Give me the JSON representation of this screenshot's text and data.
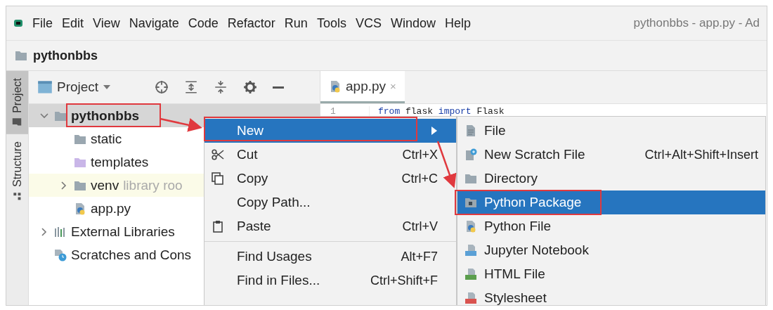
{
  "menu_bar": {
    "items": [
      "File",
      "Edit",
      "View",
      "Navigate",
      "Code",
      "Refactor",
      "Run",
      "Tools",
      "VCS",
      "Window",
      "Help"
    ],
    "window_title": "pythonbbs - app.py - Ad"
  },
  "breadcrumb": {
    "label": "pythonbbs"
  },
  "tool_strip": [
    {
      "label": "Project",
      "selected": true
    },
    {
      "label": "Structure",
      "selected": false
    }
  ],
  "project_panel": {
    "view": "Project",
    "tree": [
      {
        "label": "pythonbbs",
        "kind": "folder",
        "expanded": true,
        "selected": true,
        "library_root": false,
        "children": [
          {
            "label": "static",
            "kind": "folder",
            "selected": false,
            "library_root": false
          },
          {
            "label": "templates",
            "kind": "templates",
            "selected": false,
            "library_root": false
          },
          {
            "label": "venv",
            "kind": "folder",
            "hint": "library roo",
            "expanded": false,
            "selected": false,
            "library_root": true
          },
          {
            "label": "app.py",
            "kind": "python",
            "selected": false,
            "library_root": false
          }
        ]
      },
      {
        "label": "External Libraries",
        "kind": "libraries",
        "expanded": false,
        "selected": false,
        "library_root": false
      },
      {
        "label": "Scratches and Cons",
        "kind": "scratches",
        "selected": false,
        "library_root": false
      }
    ]
  },
  "editor": {
    "tabs": [
      {
        "label": "app.py",
        "close": "×",
        "selected": true
      }
    ],
    "line_number": "1",
    "code": [
      {
        "text": "from",
        "kind": "keyword"
      },
      {
        "text": " flask ",
        "kind": "plain"
      },
      {
        "text": "import",
        "kind": "keyword"
      },
      {
        "text": " Flask",
        "kind": "plain"
      }
    ]
  },
  "context_menu": {
    "items": [
      {
        "label": "New",
        "kind": "submenu",
        "selected": true
      },
      {
        "label": "Cut",
        "kind": "cut",
        "shortcut": "Ctrl+X",
        "selected": false
      },
      {
        "label": "Copy",
        "kind": "copy",
        "shortcut": "Ctrl+C",
        "selected": false
      },
      {
        "label": "Copy Path...",
        "kind": "plain",
        "selected": false
      },
      {
        "label": "Paste",
        "kind": "paste",
        "shortcut": "Ctrl+V",
        "selected": false
      },
      {
        "kind": "separator"
      },
      {
        "label": "Find Usages",
        "kind": "plain",
        "shortcut": "Alt+F7",
        "selected": false
      },
      {
        "label": "Find in Files...",
        "kind": "plain",
        "shortcut": "Ctrl+Shift+F",
        "selected": false
      }
    ]
  },
  "submenu": {
    "items": [
      {
        "label": "File",
        "kind": "file",
        "selected": false
      },
      {
        "label": "New Scratch File",
        "kind": "scratch",
        "shortcut": "Ctrl+Alt+Shift+Insert",
        "selected": false
      },
      {
        "label": "Directory",
        "kind": "directory",
        "selected": false
      },
      {
        "label": "Python Package",
        "kind": "package",
        "selected": true
      },
      {
        "label": "Python File",
        "kind": "python",
        "selected": false
      },
      {
        "label": "Jupyter Notebook",
        "kind": "jupyter",
        "selected": false
      },
      {
        "label": "HTML File",
        "kind": "html",
        "selected": false
      },
      {
        "label": "Stylesheet",
        "kind": "css",
        "selected": false
      }
    ]
  }
}
